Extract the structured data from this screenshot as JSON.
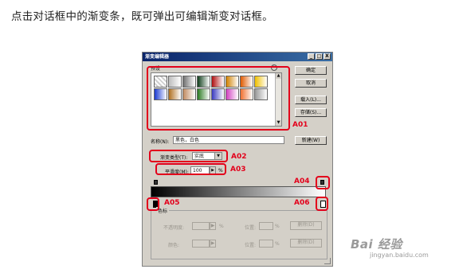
{
  "caption": "点击对话框中的渐变条，既可弹出可编辑渐变对话框。",
  "dialog": {
    "title": "渐变编辑器",
    "window_buttons": [
      "_",
      "□",
      "X"
    ],
    "buttons": {
      "ok": "确定",
      "cancel": "取消",
      "load": "载入(L)...",
      "save": "存储(S)...",
      "new": "新建(W)"
    },
    "presets_label": "预设",
    "preset_menu_icon": "triangle-menu-icon",
    "swatch_colors": [
      "#f2f2f2",
      "#bdbdbd",
      "#707070",
      "#0f3d1a",
      "#b01010",
      "#d08000",
      "#e05a00",
      "#f0c000",
      "#1a3ad0",
      "#b07020",
      "#c08a60",
      "#2a7a20",
      "#3a3ac0",
      "#d040c0",
      "#f07030",
      "#999999"
    ],
    "name_label": "名称(N):",
    "name_value": "黑色，白色",
    "gradient_type_label": "渐变类型(T):",
    "gradient_type_value": "实底",
    "smoothness_label": "平滑度(M):",
    "smoothness_value": "100",
    "smoothness_unit": "%",
    "gradient": {
      "start_color": "#000000",
      "end_color": "#ffffff"
    },
    "color_stops_group": "色标",
    "opacity_label": "不透明度:",
    "opacity_unit": "%",
    "location_label": "位置:",
    "location_unit": "%",
    "delete_label": "删除(D)",
    "color_label": "颜色:"
  },
  "annotations": {
    "a01": "A01",
    "a02": "A02",
    "a03": "A03",
    "a04": "A04",
    "a05": "A05",
    "a06": "A06",
    "color": "#e3001b"
  },
  "watermark": {
    "logo": "Bai 经验",
    "url": "jingyan.baidu.com"
  }
}
